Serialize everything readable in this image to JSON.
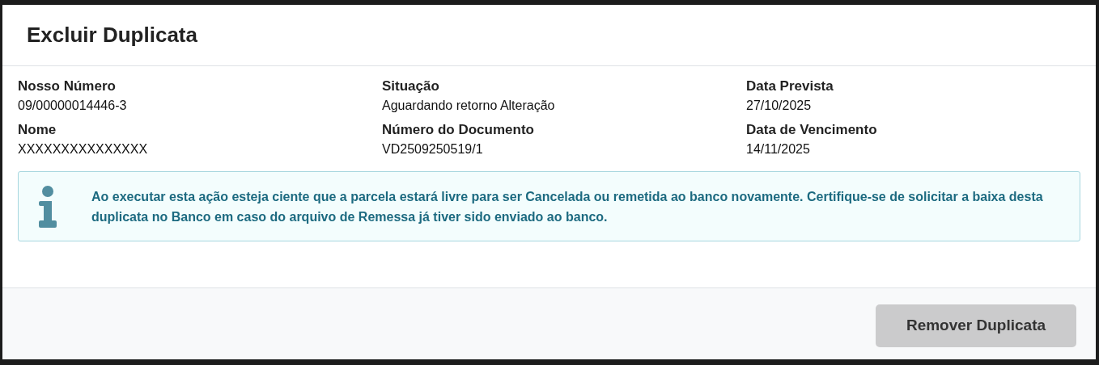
{
  "dialog": {
    "title": "Excluir Duplicata"
  },
  "fields": [
    {
      "label": "Nosso Número",
      "value": "09/00000014446-3"
    },
    {
      "label": "Situação",
      "value": "Aguardando retorno Alteração"
    },
    {
      "label": "Data Prevista",
      "value": "27/10/2025"
    },
    {
      "label": "Nome",
      "value": "XXXXXXXXXXXXXXX"
    },
    {
      "label": "Número do Documento",
      "value": "VD2509250519/1"
    },
    {
      "label": "Data de Vencimento",
      "value": "14/11/2025"
    }
  ],
  "alert": {
    "kind": "info",
    "text": "Ao executar esta ação esteja ciente que a parcela estará livre para ser Cancelada ou remetida ao banco novamente. Certifique-se de solicitar a baixa desta duplicata no Banco em caso do arquivo de Remessa já tiver sido enviado ao banco."
  },
  "buttons": [
    {
      "label": "Remover Duplicata",
      "disabled": true
    }
  ]
}
